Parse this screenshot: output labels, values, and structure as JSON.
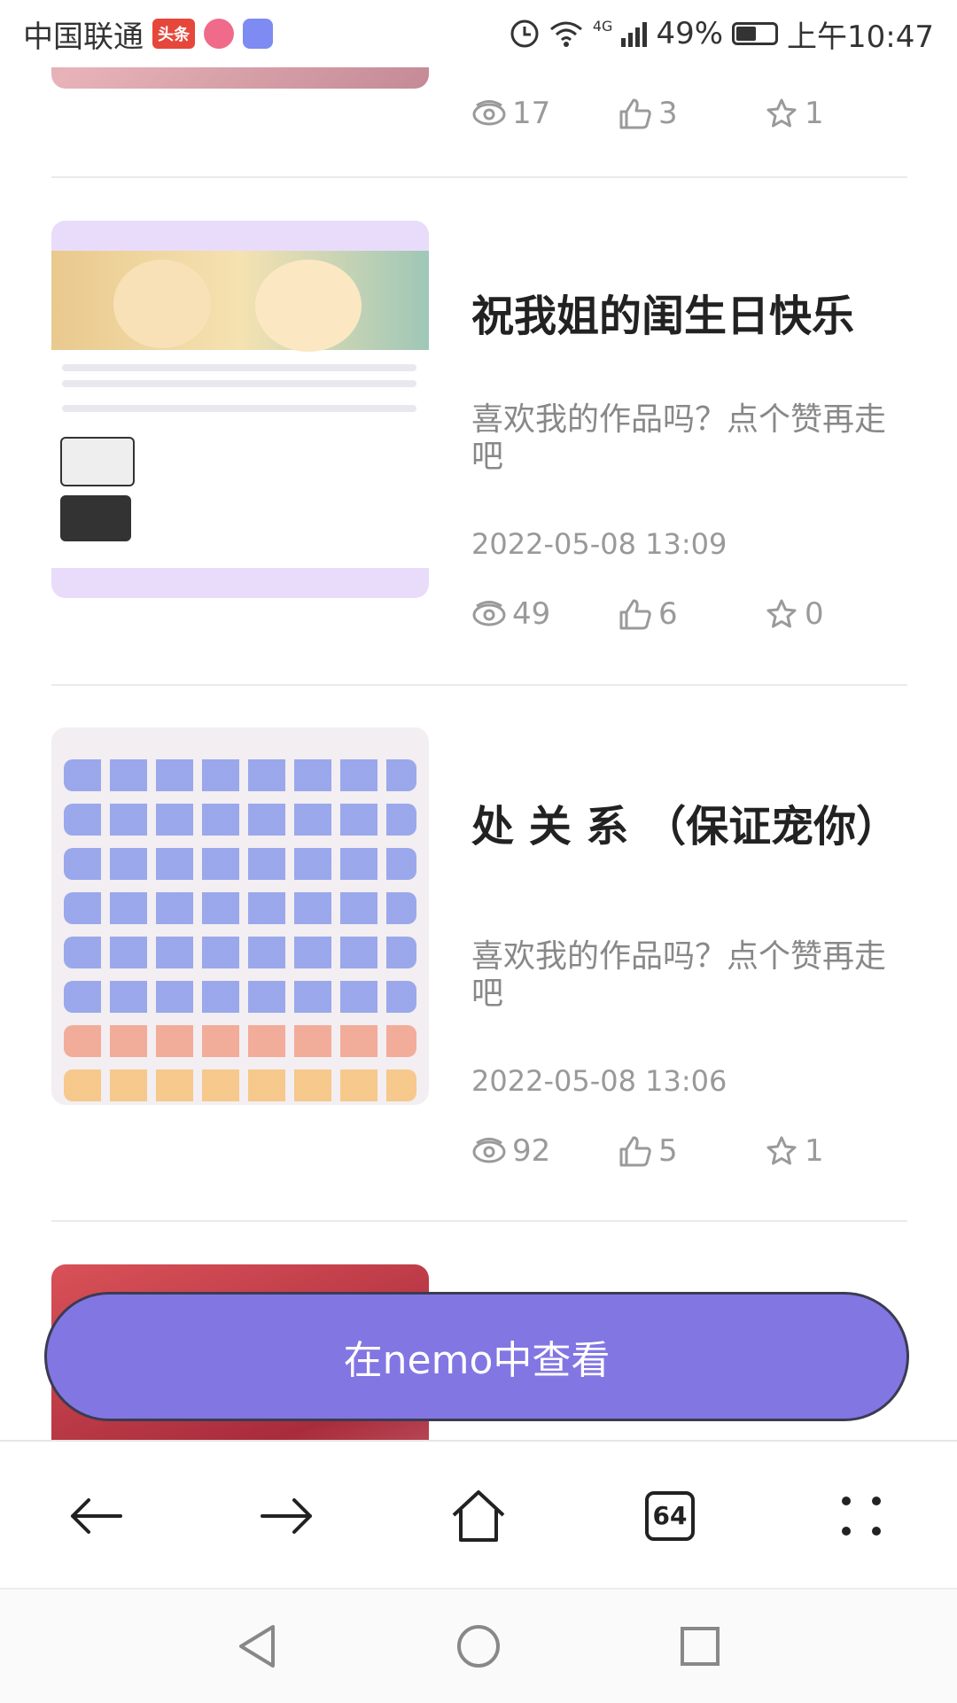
{
  "status_bar": {
    "carrier": "中国联通",
    "badge": "头条",
    "network": "4G",
    "battery": "49%",
    "time": "上午10:47"
  },
  "posts": [
    {
      "title": "",
      "desc": "",
      "date": "",
      "views": "17",
      "likes": "3",
      "favorites": "1"
    },
    {
      "title": "祝我姐的闺生日快乐",
      "desc": "喜欢我的作品吗？点个赞再走吧",
      "date": "2022-05-08 13:09",
      "views": "49",
      "likes": "6",
      "favorites": "0"
    },
    {
      "title": "处 关 系 （保证宠你）",
      "desc": "喜欢我的作品吗？点个赞再走吧",
      "date": "2022-05-08 13:06",
      "views": "92",
      "likes": "5",
      "favorites": "1"
    }
  ],
  "open_app_button": "在nemo中查看",
  "browser_toolbar": {
    "tab_count": "64",
    "icons": [
      "back-arrow-icon",
      "forward-arrow-icon",
      "home-icon",
      "tabs-icon",
      "menu-dots-icon"
    ]
  },
  "system_nav": {
    "icons": [
      "nav-back-icon",
      "nav-home-icon",
      "nav-recents-icon"
    ]
  },
  "colors": {
    "accent": "#8276e3",
    "stat_gray": "#9a9a9a",
    "desc_gray": "#888888"
  }
}
